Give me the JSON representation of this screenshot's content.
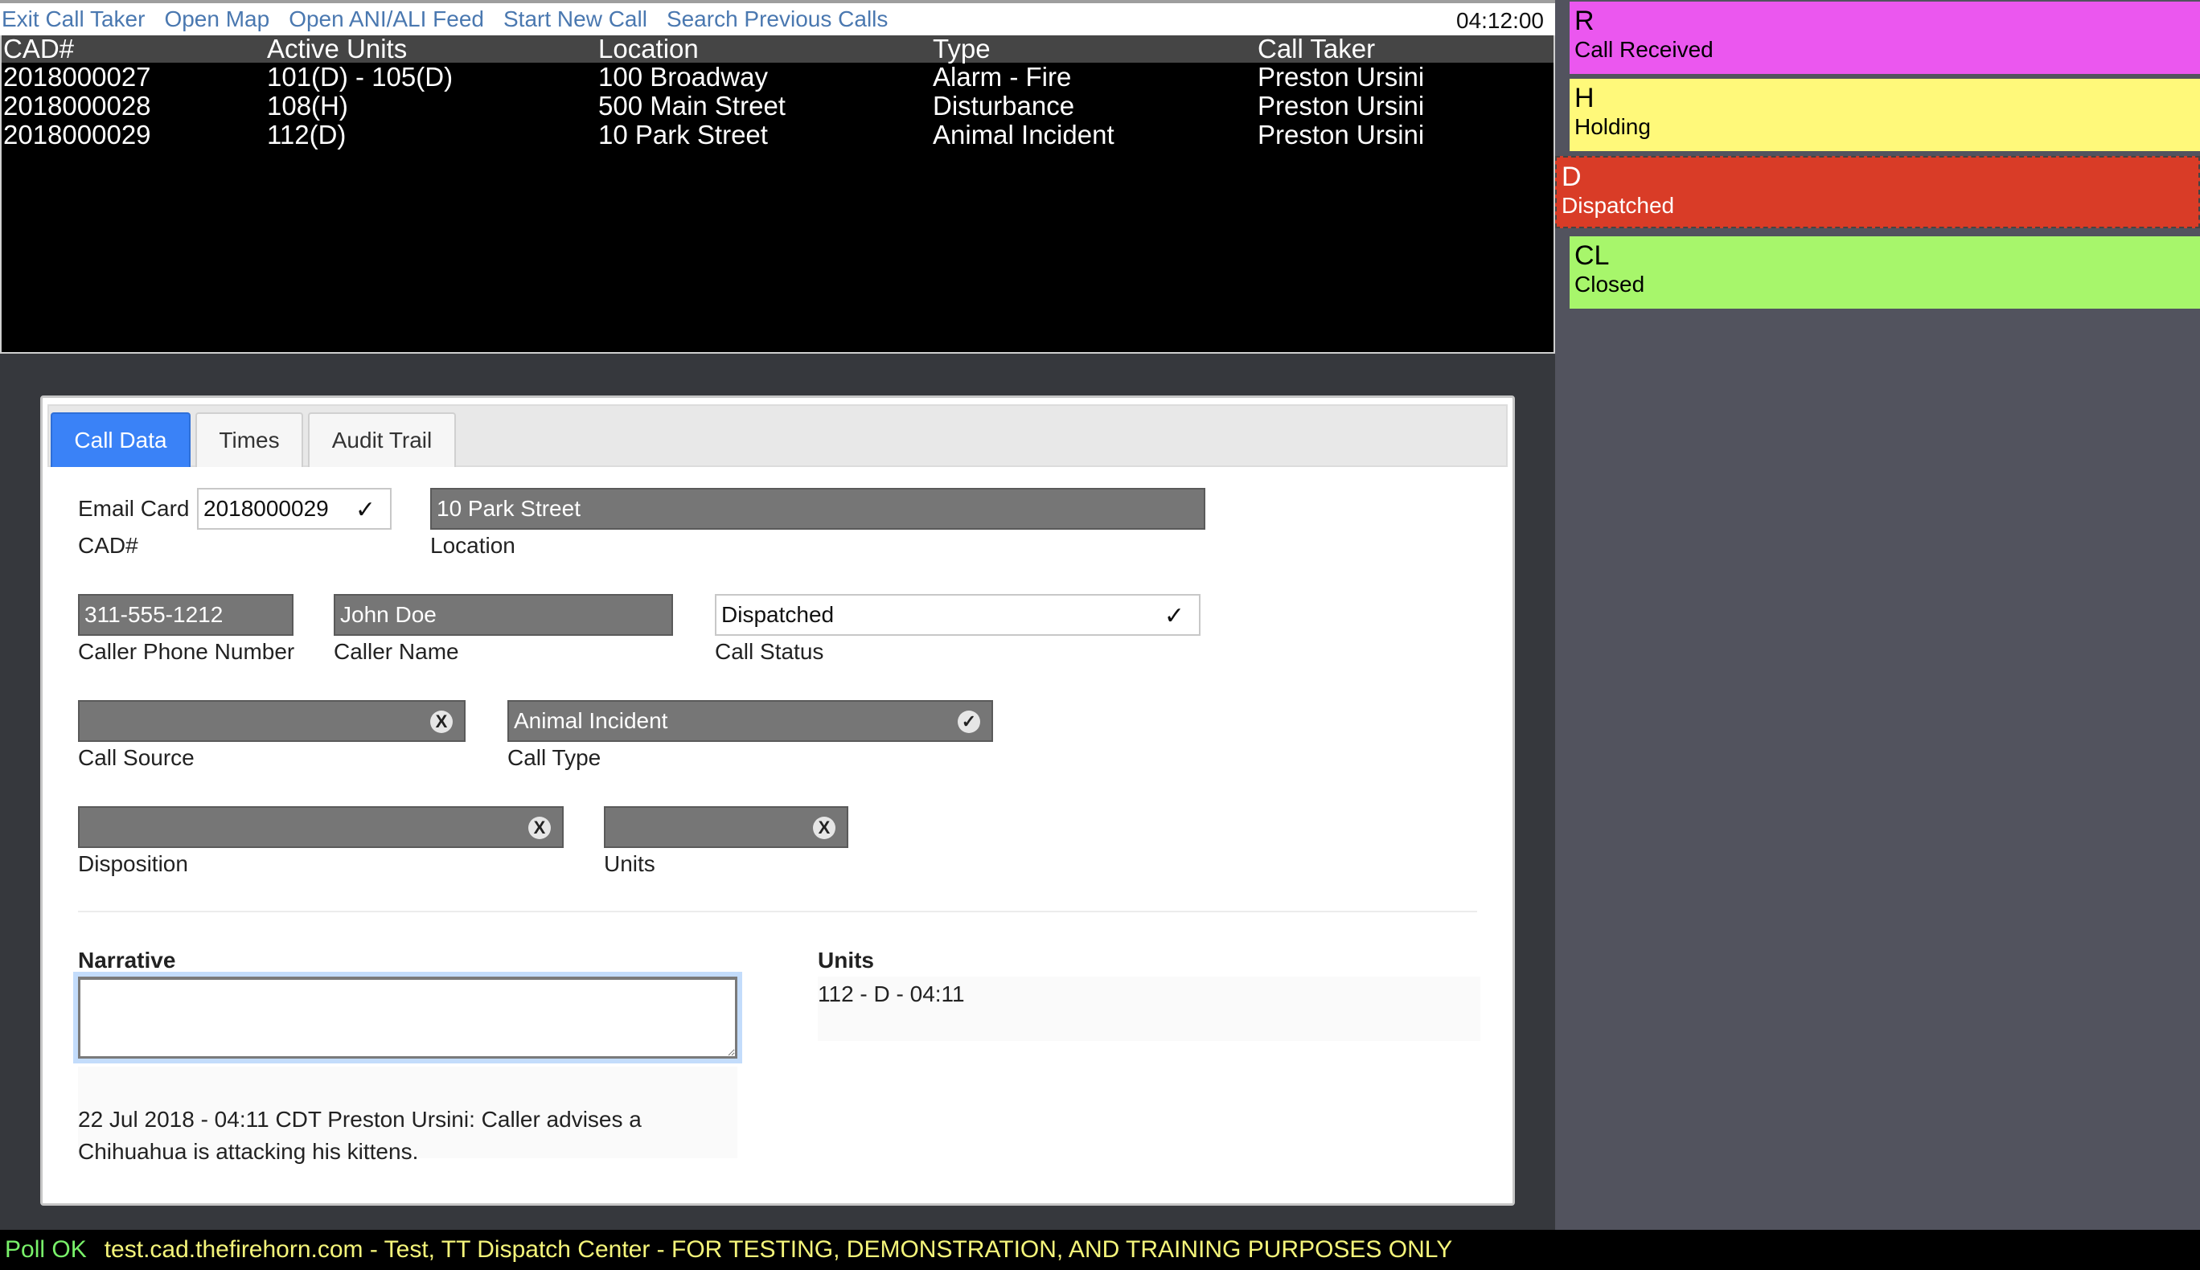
{
  "topbar": {
    "links": [
      "Exit Call Taker",
      "Open Map",
      "Open ANI/ALI Feed",
      "Start New Call",
      "Search Previous Calls"
    ],
    "clock": "04:12:00"
  },
  "calls": {
    "columns": [
      "CAD#",
      "Active Units",
      "Location",
      "Type",
      "Call Taker"
    ],
    "rows": [
      [
        "2018000027",
        "101(D) - 105(D)",
        "100 Broadway",
        "Alarm - Fire",
        "Preston Ursini"
      ],
      [
        "2018000028",
        "108(H)",
        "500 Main Street",
        "Disturbance",
        "Preston Ursini"
      ],
      [
        "2018000029",
        "112(D)",
        "10 Park Street",
        "Animal Incident",
        "Preston Ursini"
      ]
    ]
  },
  "status_tiles": [
    {
      "code": "R",
      "name": "Call Received",
      "color": "#eb57ef"
    },
    {
      "code": "H",
      "name": "Holding",
      "color": "#fff97a"
    },
    {
      "code": "D",
      "name": "Dispatched",
      "color": "#d93c27"
    },
    {
      "code": "CL",
      "name": "Closed",
      "color": "#a7f66b"
    }
  ],
  "tabs": [
    {
      "label": "Call Data",
      "active": true
    },
    {
      "label": "Times",
      "active": false
    },
    {
      "label": "Audit Trail",
      "active": false
    }
  ],
  "form": {
    "email_card_label": "Email Card",
    "cad_value": "2018000029",
    "cad_label": "CAD#",
    "location_value": "10 Park Street",
    "location_label": "Location",
    "phone_value": "311-555-1212",
    "phone_label": "Caller Phone Number",
    "caller_name_value": "John Doe",
    "caller_name_label": "Caller Name",
    "call_status_value": "Dispatched",
    "call_status_label": "Call Status",
    "call_source_value": "",
    "call_source_label": "Call Source",
    "call_type_value": "Animal Incident",
    "call_type_label": "Call Type",
    "disposition_value": "",
    "disposition_label": "Disposition",
    "units_value": "",
    "units_label": "Units",
    "check_glyph": "✓",
    "clear_glyph": "X"
  },
  "narrative": {
    "label": "Narrative",
    "value": "",
    "log_line1": "22 Jul 2018 - 04:11 CDT Preston Ursini: Caller advises a",
    "log_line2": "Chihuahua is attacking his kittens."
  },
  "units_section": {
    "label": "Units",
    "entries": [
      "112 - D - 04:11"
    ]
  },
  "footer": {
    "poll_status": "Poll OK",
    "site_text": "test.cad.thefirehorn.com - Test, TT Dispatch Center - FOR TESTING, DEMONSTRATION, AND TRAINING PURPOSES ONLY"
  }
}
